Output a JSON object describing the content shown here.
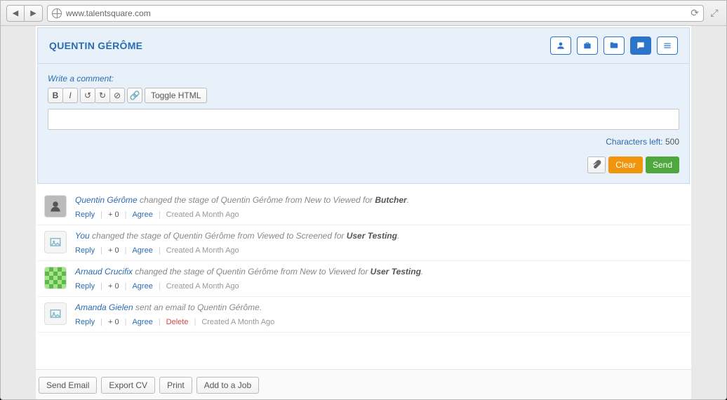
{
  "browser": {
    "url": "www.talentsquare.com"
  },
  "page_title": "QUENTIN GÉRÔME",
  "composer": {
    "label": "Write a comment:",
    "toggle_html": "Toggle HTML",
    "chars_label": "Characters left:",
    "chars_left": "500",
    "clear": "Clear",
    "send": "Send"
  },
  "meta_labels": {
    "reply": "Reply",
    "plus": "+ 0",
    "agree": "Agree",
    "delete": "Delete"
  },
  "activities": [
    {
      "actor": "Quentin Gérôme",
      "rest": " changed the stage of Quentin Gérôme from New to Viewed for ",
      "hl": "Butcher",
      "tail": ".",
      "created": "Created A Month Ago",
      "avatar": "photo",
      "deletable": false
    },
    {
      "actor": "You",
      "rest": " changed the stage of Quentin Gérôme from Viewed to Screened for ",
      "hl": "User Testing",
      "tail": ".",
      "created": "Created A Month Ago",
      "avatar": "placeholder",
      "deletable": false
    },
    {
      "actor": "Arnaud Crucifix",
      "rest": " changed the stage of Quentin Gérôme from New to Viewed for ",
      "hl": "User Testing",
      "tail": ".",
      "created": "Created A Month Ago",
      "avatar": "green",
      "deletable": false
    },
    {
      "actor": "Amanda Gielen",
      "rest": " sent an email to Quentin Gérôme.",
      "hl": "",
      "tail": "",
      "created": "Created A Month Ago",
      "avatar": "placeholder",
      "deletable": true
    }
  ],
  "footer": {
    "send_email": "Send Email",
    "export_cv": "Export CV",
    "print": "Print",
    "add_job": "Add to a Job"
  }
}
